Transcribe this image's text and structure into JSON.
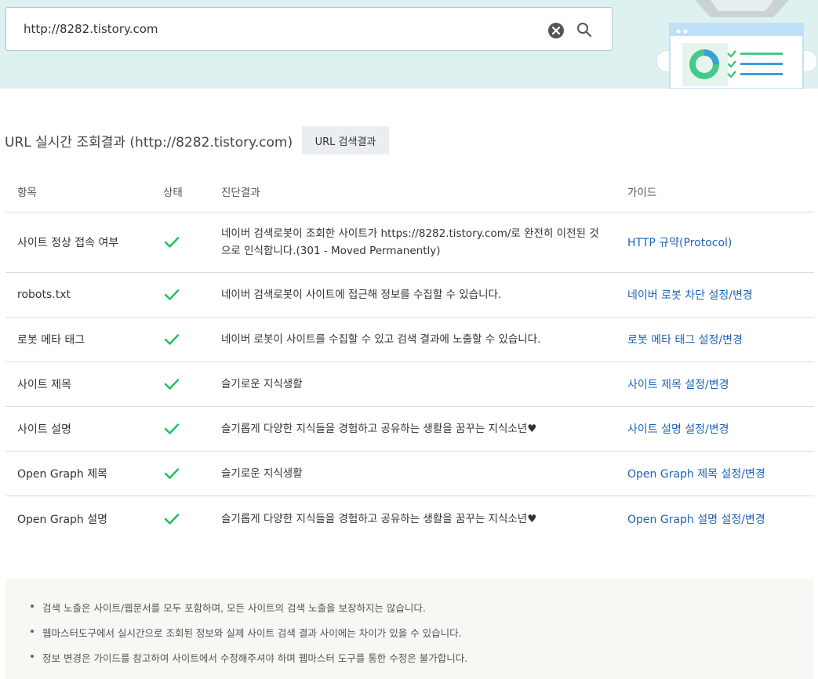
{
  "search": {
    "value": "http://8282.tistory.com",
    "clear_icon": "close-circle-icon",
    "search_icon": "search-icon"
  },
  "result": {
    "title": "URL 실시간 조회결과 (http://8282.tistory.com)",
    "url_result_button": "URL 검색결과"
  },
  "table": {
    "headers": {
      "item": "항목",
      "status": "상태",
      "result": "진단결과",
      "guide": "가이드"
    },
    "rows": [
      {
        "item": "사이트 정상 접속 여부",
        "status": "check-icon",
        "result": "네이버 검색로봇이 조회한 사이트가 https://8282.tistory.com/로 완전히 이전된 것으로 인식합니다.(301 - Moved Permanently)",
        "guide": "HTTP 규약(Protocol)"
      },
      {
        "item": "robots.txt",
        "status": "check-icon",
        "result": "네이버 검색로봇이 사이트에 접근해 정보를 수집할 수 있습니다.",
        "guide": "네이버 로봇 차단 설정/변경"
      },
      {
        "item": "로봇 메타 태그",
        "status": "check-icon",
        "result": "네이버 로봇이 사이트를 수집할 수 있고 검색 결과에 노출할 수 있습니다.",
        "guide": "로봇 메타 태그 설정/변경"
      },
      {
        "item": "사이트 제목",
        "status": "check-icon",
        "result": "슬기로운 지식생활",
        "guide": "사이트 제목 설정/변경"
      },
      {
        "item": "사이트 설명",
        "status": "check-icon",
        "result": "슬기롭게 다양한 지식들을 경험하고 공유하는 생활을 꿈꾸는 지식소년♥",
        "guide": "사이트 설명 설정/변경"
      },
      {
        "item": "Open Graph 제목",
        "status": "check-icon",
        "result": "슬기로운 지식생활",
        "guide": "Open Graph 제목 설정/변경"
      },
      {
        "item": "Open Graph 설명",
        "status": "check-icon",
        "result": "슬기롭게 다양한 지식들을 경험하고 공유하는 생활을 꿈꾸는 지식소년♥",
        "guide": "Open Graph 설명 설정/변경"
      }
    ]
  },
  "notice": [
    "검색 노출은 사이트/웹문서를 모두 포함하며, 모든 사이트의 검색 노출을 보장하지는 않습니다.",
    "웹마스터도구에서 실시간으로 조회된 정보와 실제 사이트 검색 결과 사이에는 차이가 있을 수 있습니다.",
    "정보 변경은 가이드를 참고하여 사이트에서 수정해주셔야 하며 웹마스터 도구를 통한 수정은 불가합니다."
  ],
  "colors": {
    "band": "#ddf2f0",
    "check": "#19c35a",
    "link": "#1e63b4",
    "notice_bg": "#f8f7f4"
  }
}
